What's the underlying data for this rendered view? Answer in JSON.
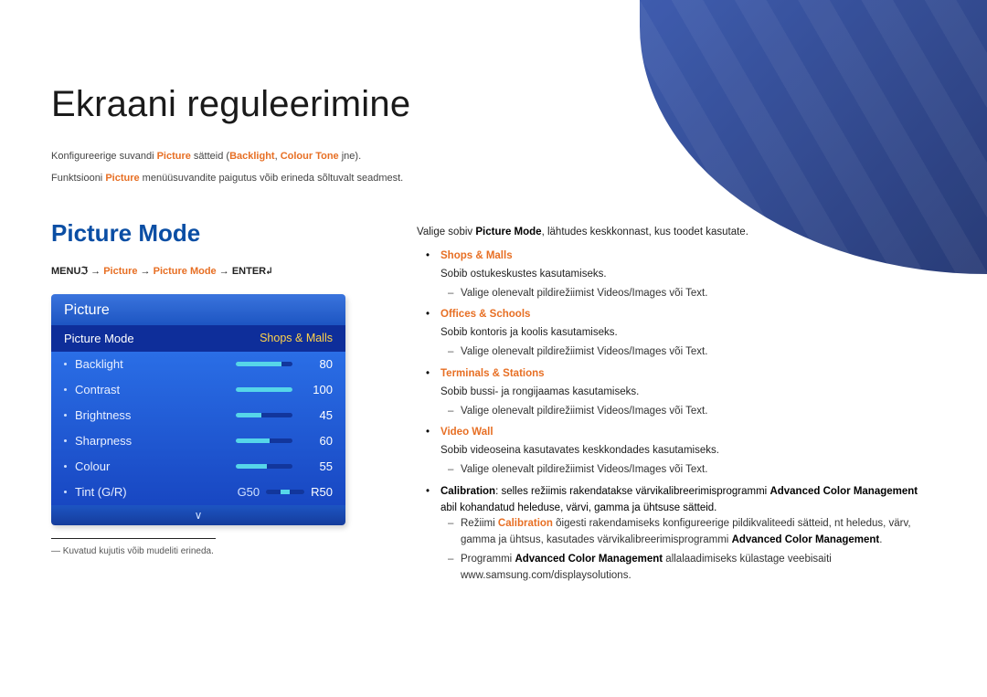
{
  "page": {
    "title": "Ekraani reguleerimine",
    "intro1_pre": "Konfigureerige suvandi ",
    "intro1_hl1": "Picture",
    "intro1_mid": " sätteid (",
    "intro1_hl2": "Backlight",
    "intro1_sep": ", ",
    "intro1_hl3": "Colour Tone",
    "intro1_post": " jne).",
    "intro2_pre": "Funktsiooni ",
    "intro2_hl": "Picture",
    "intro2_post": " menüüsuvandite paigutus võib erineda sõltuvalt seadmest.",
    "footnote": "Kuvatud kujutis võib mudeliti erineda."
  },
  "section": {
    "heading": "Picture Mode",
    "path_menu": "MENU",
    "path_sym1": "ℑ",
    "path_arrow": " → ",
    "path_p1": "Picture",
    "path_p2": "Picture Mode",
    "path_enter": "ENTER",
    "path_sym2": "↲"
  },
  "osd": {
    "title": "Picture",
    "selected_label": "Picture Mode",
    "selected_value": "Shops & Malls",
    "rows": [
      {
        "label": "Backlight",
        "value": "80",
        "fill": 80
      },
      {
        "label": "Contrast",
        "value": "100",
        "fill": 100
      },
      {
        "label": "Brightness",
        "value": "45",
        "fill": 45
      },
      {
        "label": "Sharpness",
        "value": "60",
        "fill": 60
      },
      {
        "label": "Colour",
        "value": "55",
        "fill": 55
      }
    ],
    "tint_label": "Tint (G/R)",
    "tint_g": "G50",
    "tint_r": "R50",
    "chevron": "∨"
  },
  "right": {
    "lead_pre": "Valige sobiv ",
    "lead_hl": "Picture Mode",
    "lead_post": ", lähtudes keskkonnast, kus toodet kasutate.",
    "items": [
      {
        "head": "Shops & Malls",
        "desc": "Sobib ostukeskustes kasutamiseks.",
        "sub_pre": "Valige olenevalt pildirežiimist ",
        "sub_hl1": "Videos/Images",
        "sub_mid": " või ",
        "sub_hl2": "Text",
        "sub_post": "."
      },
      {
        "head": "Offices & Schools",
        "desc": "Sobib kontoris ja koolis kasutamiseks.",
        "sub_pre": "Valige olenevalt pildirežiimist ",
        "sub_hl1": "Videos/Images",
        "sub_mid": " või ",
        "sub_hl2": "Text",
        "sub_post": "."
      },
      {
        "head": "Terminals & Stations",
        "desc": "Sobib bussi- ja rongijaamas kasutamiseks.",
        "sub_pre": "Valige olenevalt pildirežiimist ",
        "sub_hl1": "Videos/Images",
        "sub_mid": " või ",
        "sub_hl2": "Text",
        "sub_post": "."
      },
      {
        "head": "Video Wall",
        "desc": "Sobib videoseina kasutavates keskkondades kasutamiseks.",
        "sub_pre": "Valige olenevalt pildirežiimist ",
        "sub_hl1": "Videos/Images",
        "sub_mid": " või ",
        "sub_hl2": "Text",
        "sub_post": "."
      }
    ],
    "calib_head_b": "Calibration",
    "calib_head_rest": ": selles režiimis rakendatakse värvikalibreerimisprogrammi ",
    "calib_head_b2": "Advanced Color Management",
    "calib_head_rest2": " abil kohandatud heleduse, värvi, gamma ja ühtsuse sätteid.",
    "calib_d1_pre": "Režiimi ",
    "calib_d1_hl": "Calibration",
    "calib_d1_mid": " õigesti rakendamiseks konfigureerige pildikvaliteedi sätteid, nt heledus, värv, gamma ja ühtsus, kasutades värvikalibreerimisprogrammi ",
    "calib_d1_b": "Advanced Color Management",
    "calib_d1_post": ".",
    "calib_d2_pre": "Programmi ",
    "calib_d2_b": "Advanced Color Management",
    "calib_d2_post": " allalaadimiseks külastage veebisaiti www.samsung.com/displaysolutions."
  }
}
